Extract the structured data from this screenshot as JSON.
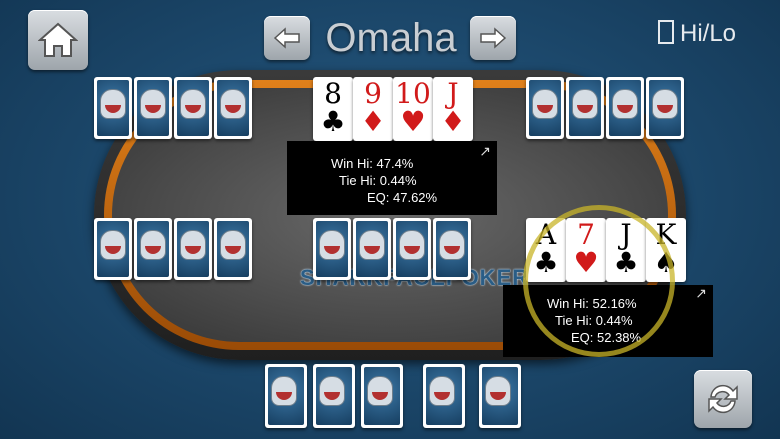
{
  "header": {
    "title": "Omaha",
    "hilo_label": "Hi/Lo",
    "home_icon": "home-icon",
    "prev_icon": "arrow-left-icon",
    "next_icon": "arrow-right-icon",
    "refresh_icon": "refresh-icon"
  },
  "table": {
    "logo_text": "SHARKFACEPOKER"
  },
  "community_cards": [
    {
      "rank": "8",
      "suit": "♣",
      "color": "#111111"
    },
    {
      "rank": "9",
      "suit": "♦",
      "color": "#d11a1a"
    },
    {
      "rank": "10",
      "suit": "♥",
      "color": "#d11a1a"
    },
    {
      "rank": "J",
      "suit": "♦",
      "color": "#d11a1a"
    }
  ],
  "hand_top": {
    "win_hi": "Win Hi: 47.4%",
    "tie_hi": "Tie Hi: 0.44%",
    "eq": "EQ: 47.62%"
  },
  "hand_right": {
    "cards": [
      {
        "rank": "A",
        "suit": "♣",
        "color": "#111111"
      },
      {
        "rank": "7",
        "suit": "♥",
        "color": "#d11a1a"
      },
      {
        "rank": "J",
        "suit": "♣",
        "color": "#111111"
      },
      {
        "rank": "K",
        "suit": "♠",
        "color": "#111111"
      }
    ],
    "win_hi": "Win Hi: 52.16%",
    "tie_hi": "Tie Hi: 0.44%",
    "eq": "EQ: 52.38%"
  },
  "colors": {
    "accent": "#e0801a",
    "background": "#1d4a6e",
    "highlight": "#c8b428"
  }
}
